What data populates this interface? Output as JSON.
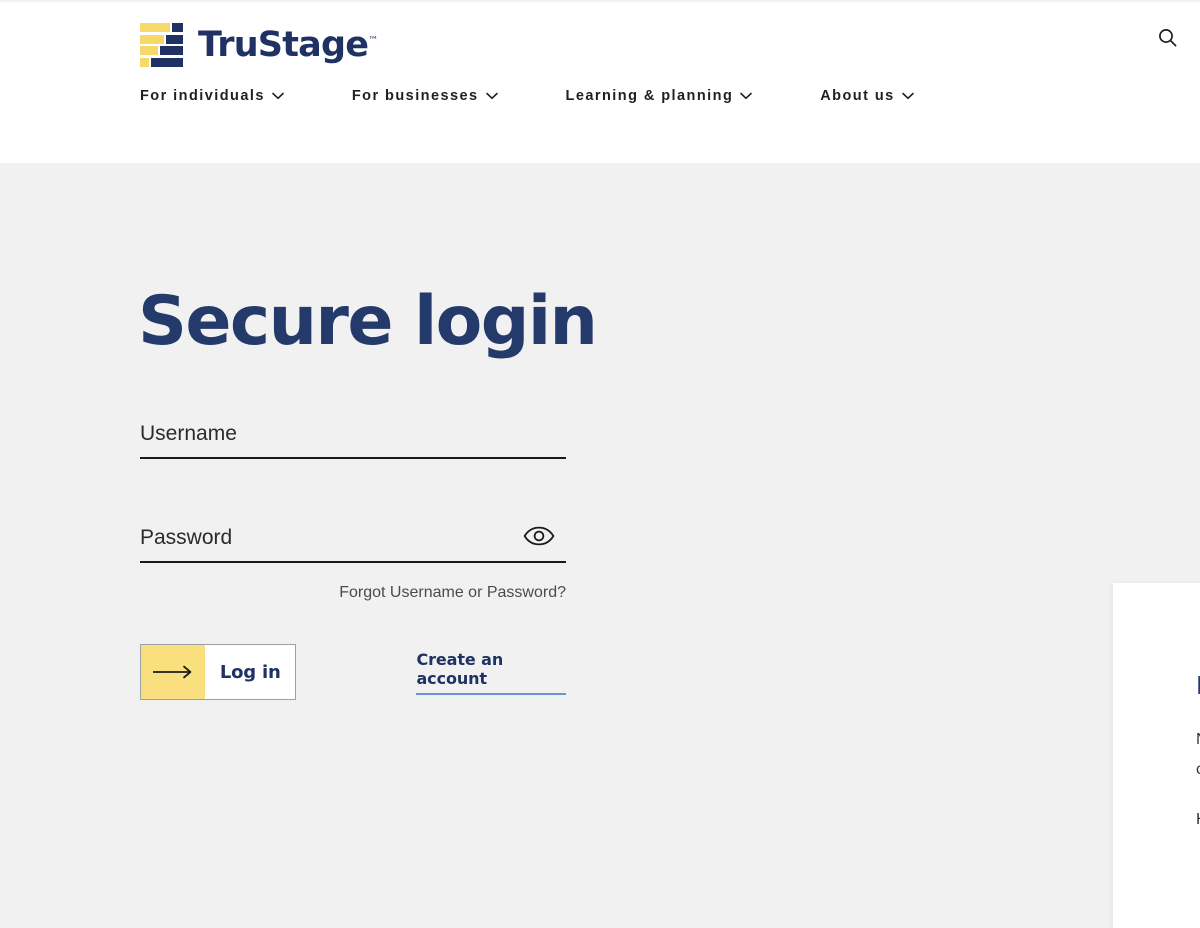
{
  "header": {
    "logo": {
      "mark_name": "trustage-logo-mark",
      "wordmark": "TruStage",
      "trademark": "™",
      "yellow": "#f7d96b",
      "navy": "#1f3263"
    },
    "search_icon": "search-icon",
    "nav": [
      {
        "label": "For individuals",
        "icon": "chevron-down-icon"
      },
      {
        "label": "For businesses",
        "icon": "chevron-down-icon"
      },
      {
        "label": "Learning & planning",
        "icon": "chevron-down-icon"
      },
      {
        "label": "About us",
        "icon": "chevron-down-icon"
      }
    ]
  },
  "login": {
    "title": "Secure login",
    "username": {
      "label": "Username",
      "placeholder": "Username",
      "value": ""
    },
    "password": {
      "label": "Password",
      "placeholder": "Password",
      "value": "",
      "toggle_icon": "eye-icon"
    },
    "forgot_link": "Forgot Username or Password?",
    "submit": {
      "label": "Log in",
      "icon": "arrow-right-icon",
      "accent": "#fadf7e"
    },
    "create_account": "Create an account"
  },
  "side_panel": {
    "title": "N",
    "line1": "N",
    "line2": "c",
    "line3": "H"
  },
  "colors": {
    "page_background": "#f1f1f1",
    "header_background": "#ffffff",
    "brand_navy": "#1f3263",
    "brand_yellow": "#f7d96b",
    "heading_navy": "#243a6b",
    "link_underline": "#6f8fd6"
  }
}
